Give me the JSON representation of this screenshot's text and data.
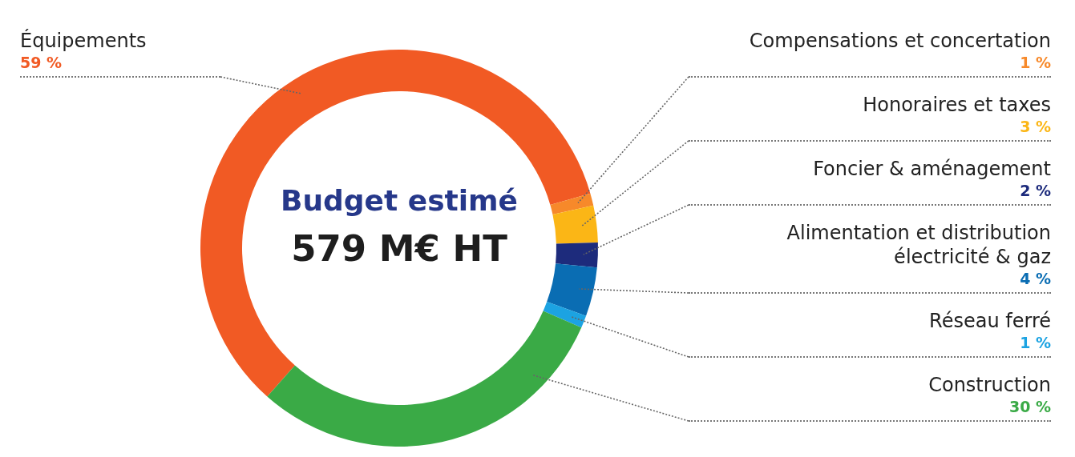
{
  "chart_data": {
    "type": "donut",
    "categories": [
      "Équipements",
      "Compensations et concertation",
      "Honoraires et taxes",
      "Foncier & aménagement",
      "Alimentation et distribution électricité & gaz",
      "Réseau ferré",
      "Construction"
    ],
    "values": [
      59,
      1,
      3,
      2,
      4,
      1,
      30
    ]
  },
  "center": {
    "title": "Budget estimé",
    "amount": "579 M€ HT"
  },
  "legend": [
    {
      "value": "59 %",
      "color": "#f15a24"
    },
    {
      "value": "1 %",
      "color": "#f7892a"
    },
    {
      "value": "3 %",
      "color": "#fbb616"
    },
    {
      "value": "2 %",
      "color": "#1d2b7c"
    },
    {
      "value": "4 %",
      "color": "#0a6db3"
    },
    {
      "value": "1 %",
      "color": "#1ca3e2"
    },
    {
      "value": "30 %",
      "color": "#3aaa46"
    }
  ]
}
